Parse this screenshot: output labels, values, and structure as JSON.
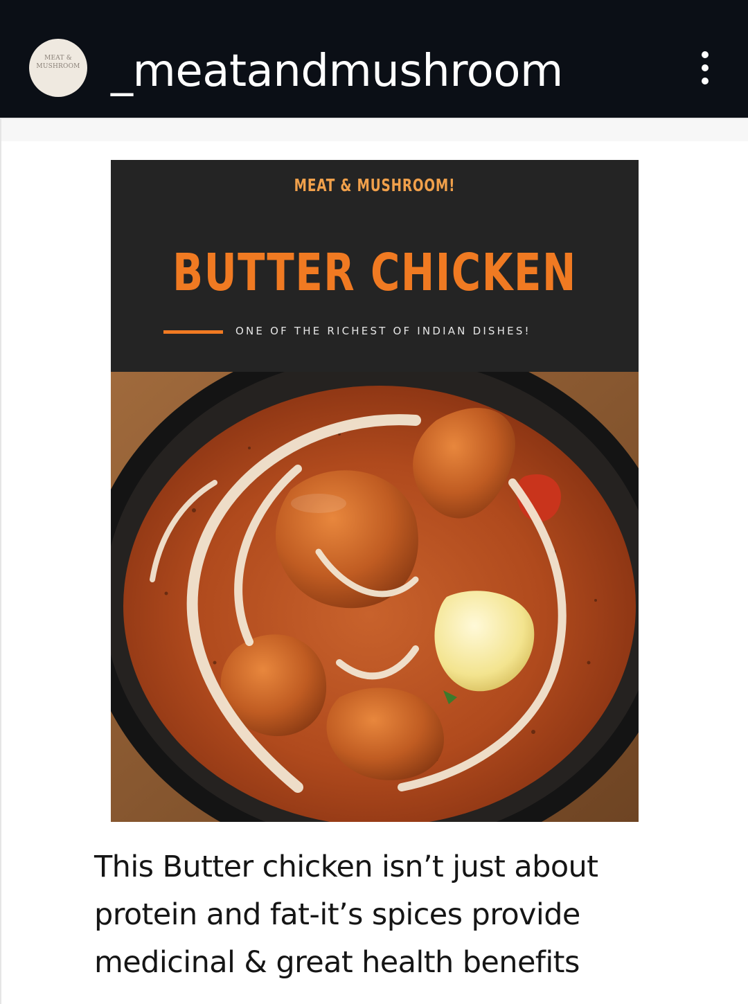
{
  "header": {
    "username": "_meatandmushroom",
    "avatar_text_line1": "MEAT &",
    "avatar_text_line2": "MUSHROOM",
    "more_icon": "vertical-ellipsis-icon"
  },
  "post": {
    "brand": "MEAT & MUSHROOM!",
    "title": "BUTTER CHICKEN",
    "tagline": "ONE OF THE RICHEST OF INDIAN DISHES!",
    "photo_subject": "butter chicken in a dark bowl with cream swirl and butter",
    "colors": {
      "header_bg": "#242424",
      "brand": "#f0a04b",
      "title": "#f07a22",
      "sauce": "#b24b1e"
    }
  },
  "caption": {
    "line1": "This Butter chicken isn’t just about",
    "line2": "protein and fat-it’s spices provide",
    "line3": "medicinal & great health benefits"
  }
}
